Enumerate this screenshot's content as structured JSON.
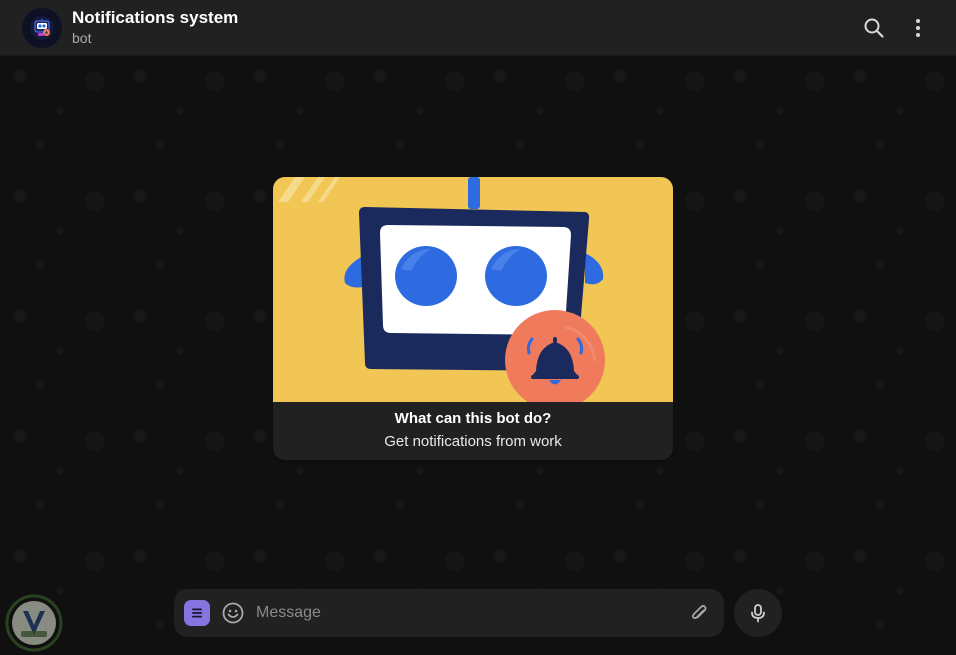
{
  "header": {
    "title": "Notifications system",
    "subtitle": "bot",
    "avatar_icon": "robot-icon",
    "search_icon": "search-icon",
    "more_icon": "more-vertical-icon"
  },
  "bot_card": {
    "heading": "What can this bot do?",
    "description": "Get notifications from work",
    "illustration": "robot-with-bell-illustration"
  },
  "composer": {
    "placeholder": "Message",
    "value": "",
    "menu_icon": "menu-icon",
    "emoji_icon": "emoji-icon",
    "attach_icon": "paperclip-icon",
    "mic_icon": "microphone-icon"
  },
  "colors": {
    "header_bg": "#212121",
    "chat_bg": "#0f0f0f",
    "accent": "#8774e1",
    "card_yellow": "#f1c654",
    "robot_navy": "#1b2a5c",
    "robot_eye_blue": "#2f6be0",
    "bell_orange": "#f07a5c"
  }
}
